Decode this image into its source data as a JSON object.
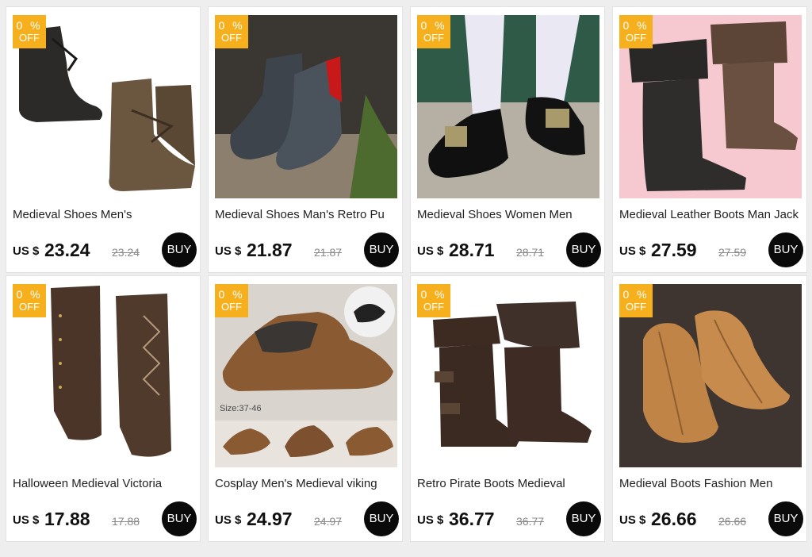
{
  "products": [
    {
      "badge_pct": "0 %",
      "badge_off": "OFF",
      "title": "Medieval Shoes Men's",
      "currency": "US $",
      "price": "23.24",
      "old_price": "23.24",
      "buy_label": "BUY",
      "image": "boot-pair-dark-brown-laced"
    },
    {
      "badge_pct": "0 %",
      "badge_off": "OFF",
      "title": "Medieval Shoes Man's Retro Pu",
      "currency": "US $",
      "price": "21.87",
      "old_price": "21.87",
      "buy_label": "BUY",
      "image": "ankle-boots-black-red-lining"
    },
    {
      "badge_pct": "0 %",
      "badge_off": "OFF",
      "title": "Medieval Shoes Women Men",
      "currency": "US $",
      "price": "28.71",
      "old_price": "28.71",
      "buy_label": "BUY",
      "image": "buckle-shoes-white-stockings"
    },
    {
      "badge_pct": "0 %",
      "badge_off": "OFF",
      "title": "Medieval Leather Boots Man Jack",
      "currency": "US $",
      "price": "27.59",
      "old_price": "27.59",
      "buy_label": "BUY",
      "image": "cuffed-tall-boots-pink-bg"
    },
    {
      "badge_pct": "0 %",
      "badge_off": "OFF",
      "title": "Halloween Medieval Victoria",
      "currency": "US $",
      "price": "17.88",
      "old_price": "17.88",
      "buy_label": "BUY",
      "image": "boot-covers-brown-laced"
    },
    {
      "badge_pct": "0 %",
      "badge_off": "OFF",
      "title": "Cosplay Men's Medieval viking",
      "currency": "US $",
      "price": "24.97",
      "old_price": "24.97",
      "buy_label": "BUY",
      "image": "viking-shoes-brown",
      "image_text": "Size:37-46"
    },
    {
      "badge_pct": "0 %",
      "badge_off": "OFF",
      "title": "Retro Pirate Boots Medieval",
      "currency": "US $",
      "price": "36.77",
      "old_price": "36.77",
      "buy_label": "BUY",
      "image": "pirate-boots-buckles"
    },
    {
      "badge_pct": "0 %",
      "badge_off": "OFF",
      "title": "Medieval Boots Fashion Men",
      "currency": "US $",
      "price": "26.66",
      "old_price": "26.66",
      "buy_label": "BUY",
      "image": "tan-suede-ankle-shoes"
    }
  ],
  "colors": {
    "badge": "#f6b01e",
    "buy_button": "#0a0a0a",
    "background": "#eeeeee"
  }
}
